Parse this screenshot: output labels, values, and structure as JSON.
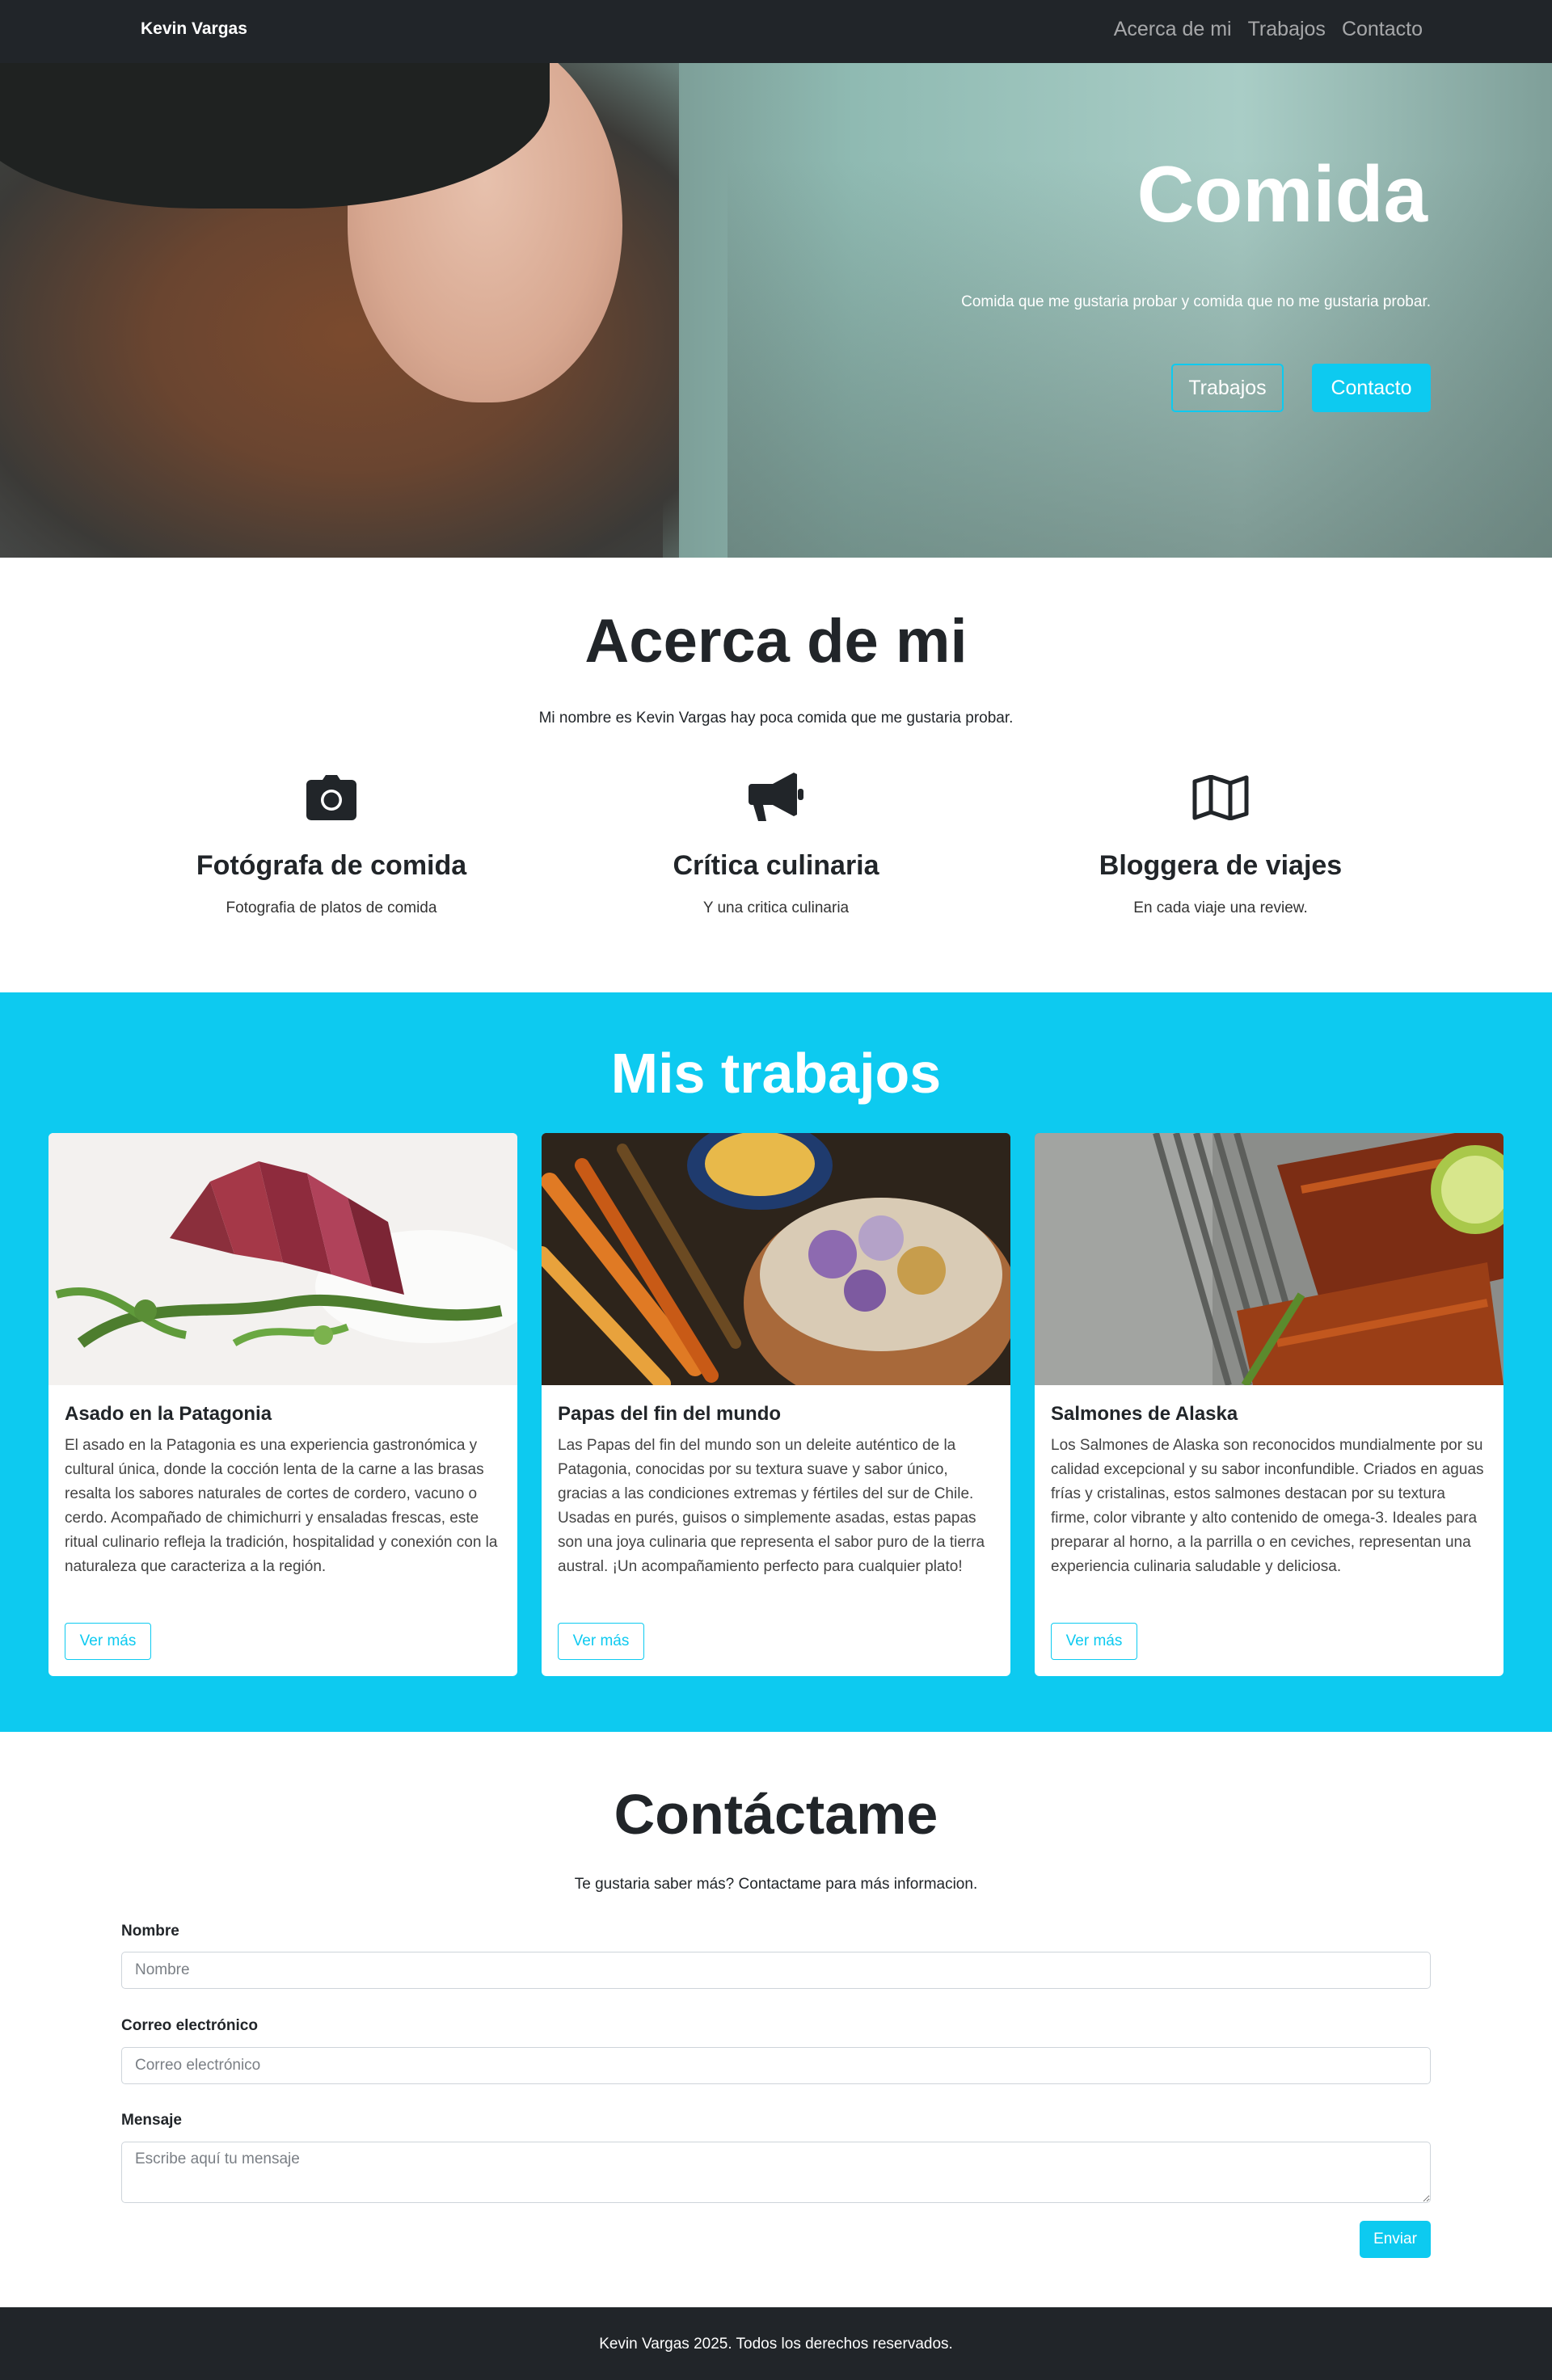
{
  "nav": {
    "brand": "Kevin Vargas",
    "links": [
      "Acerca de mi",
      "Trabajos",
      "Contacto"
    ]
  },
  "hero": {
    "title": "Comida",
    "subtitle": "Comida que me gustaria probar y comida que no me gustaria probar.",
    "btn_outline": "Trabajos",
    "btn_solid": "Contacto"
  },
  "about": {
    "title": "Acerca de mi",
    "description": "Mi nombre es Kevin Vargas hay poca comida que me gustaria probar.",
    "features": [
      {
        "icon": "camera-icon",
        "title": "Fotógrafa de comida",
        "text": "Fotografia de platos de comida"
      },
      {
        "icon": "megaphone-icon",
        "title": "Crítica culinaria",
        "text": "Y una critica culinaria"
      },
      {
        "icon": "map-icon",
        "title": "Bloggera de viajes",
        "text": "En cada viaje una review."
      }
    ]
  },
  "works": {
    "title": "Mis trabajos",
    "cards": [
      {
        "title": "Asado en la Patagonia",
        "text": "El asado en la Patagonia es una experiencia gastronómica y cultural única, donde la cocción lenta de la carne a las brasas resalta los sabores naturales de cortes de cordero, vacuno o cerdo. Acompañado de chimichurri y ensaladas frescas, este ritual culinario refleja la tradición, hospitalidad y conexión con la naturaleza que caracteriza a la región.",
        "button": "Ver más"
      },
      {
        "title": "Papas del fin del mundo",
        "text": "Las Papas del fin del mundo son un deleite auténtico de la Patagonia, conocidas por su textura suave y sabor único, gracias a las condiciones extremas y fértiles del sur de Chile. Usadas en purés, guisos o simplemente asadas, estas papas son una joya culinaria que representa el sabor puro de la tierra austral. ¡Un acompañamiento perfecto para cualquier plato!",
        "button": "Ver más"
      },
      {
        "title": "Salmones de Alaska",
        "text": "Los Salmones de Alaska son reconocidos mundialmente por su calidad excepcional y su sabor inconfundible. Criados en aguas frías y cristalinas, estos salmones destacan por su textura firme, color vibrante y alto contenido de omega-3. Ideales para preparar al horno, a la parrilla o en ceviches, representan una experiencia culinaria saludable y deliciosa.",
        "button": "Ver más"
      }
    ]
  },
  "contact": {
    "title": "Contáctame",
    "description": "Te gustaria saber más? Contactame para más informacion.",
    "name_label": "Nombre",
    "name_placeholder": "Nombre",
    "email_label": "Correo electrónico",
    "email_placeholder": "Correo electrónico",
    "message_label": "Mensaje",
    "message_placeholder": "Escribe aquí tu mensaje",
    "send": "Enviar"
  },
  "footer": {
    "text": "Kevin Vargas 2025. Todos los derechos reservados."
  },
  "colors": {
    "accent": "#0dcaf0",
    "dark": "#212529"
  }
}
